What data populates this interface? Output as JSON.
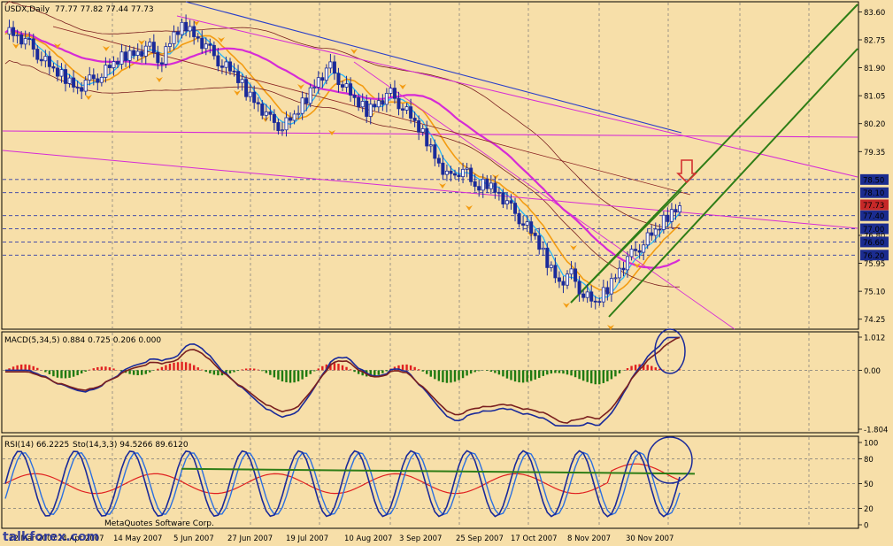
{
  "chart_data": [
    {
      "type": "candlestick",
      "panel": "price",
      "title": "USDX,Daily",
      "ohlc_header": "77.77 77.82 77.44 77.73",
      "last_price": "77.73",
      "price_ticks": [
        "83.60",
        "82.75",
        "81.90",
        "81.05",
        "80.20",
        "79.35",
        "78.50",
        "78.10",
        "77.40",
        "77.00",
        "76.80",
        "76.60",
        "76.20",
        "75.95",
        "75.10",
        "74.25"
      ],
      "highlighted_levels": [
        "78.50",
        "78.10",
        "77.40",
        "77.00",
        "76.60",
        "76.20"
      ],
      "ylim": [
        74.0,
        83.8
      ],
      "date_labels": [
        "22 Mar 2007",
        "24 Apr 2007",
        "14 May 2007",
        "5 Jun 2007",
        "27 Jun 2007",
        "19 Jul 2007",
        "10 Aug 2007",
        "3 Sep 2007",
        "25 Sep 2007",
        "17 Oct 2007",
        "8 Nov 2007",
        "30 Nov 2007"
      ],
      "grid": "dashed vertical",
      "series_close_approx": [
        83.1,
        82.9,
        82.6,
        82.2,
        81.8,
        81.6,
        81.3,
        81.5,
        81.7,
        82.0,
        82.3,
        82.4,
        82.5,
        82.1,
        82.9,
        83.2,
        82.8,
        82.4,
        82.0,
        81.7,
        81.2,
        80.8,
        80.3,
        80.1,
        80.4,
        81.0,
        81.6,
        81.9,
        81.4,
        80.9,
        80.6,
        80.9,
        81.1,
        80.7,
        80.2,
        79.7,
        79.0,
        78.5,
        78.9,
        78.2,
        78.4,
        78.1,
        77.6,
        77.2,
        76.7,
        76.0,
        75.4,
        75.6,
        75.0,
        74.7,
        75.2,
        75.8,
        76.2,
        76.6,
        76.9,
        77.4,
        77.7
      ]
    },
    {
      "type": "histogram",
      "panel": "macd",
      "label": "MACD(5,34,5) 0.884 0.725 0.206 0.000",
      "ticks": [
        "1.012",
        "0.00",
        "-1.804"
      ],
      "ylim": [
        -1.804,
        1.012
      ]
    },
    {
      "type": "line",
      "panel": "oscillator",
      "label": "RSI(14) 66.2225",
      "label2": "Sto(14,3,3) 94.5266 89.6120",
      "ticks": [
        "100",
        "80",
        "50",
        "20",
        "0"
      ],
      "ylim": [
        0,
        100
      ]
    }
  ],
  "footer": {
    "copyright": "MetaQuotes Software Corp.",
    "watermark": "talkforex.com"
  },
  "colors": {
    "background": "#f7dfa9",
    "axis_panel": "#f7dfa9",
    "level_box": "#1b2c8f",
    "last_price_box": "#c62828",
    "up_candle": "#1a2a9a",
    "ma_magenta": "#d62bd6",
    "ma_orange": "#f39c12",
    "ma_cyan": "#29b6f6",
    "channel_green": "#2e7d16",
    "macd_up": "#e02020",
    "macd_down": "#1e7a10"
  }
}
